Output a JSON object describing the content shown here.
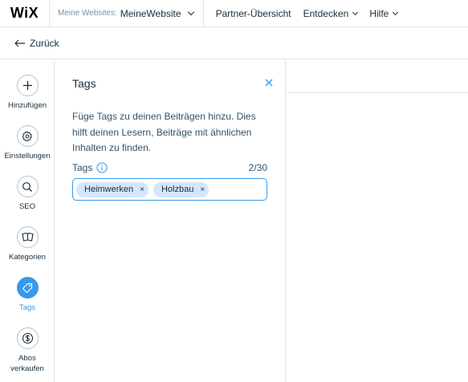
{
  "topbar": {
    "logo": "WiX",
    "site_prefix": "Meine Websites:",
    "site_name": "MeineWebsite",
    "nav": [
      {
        "label": "Partner-Übersicht"
      },
      {
        "label": "Entdecken"
      },
      {
        "label": "Hilfe"
      }
    ]
  },
  "back": {
    "label": "Zurück"
  },
  "rail": {
    "items": [
      {
        "label": "Hinzufügen",
        "icon": "plus-icon"
      },
      {
        "label": "Einstellungen",
        "icon": "gear-icon"
      },
      {
        "label": "SEO",
        "icon": "search-icon"
      },
      {
        "label": "Kategorien",
        "icon": "category-icon"
      },
      {
        "label": "Tags",
        "icon": "tag-icon",
        "active": true
      },
      {
        "label": "Abos verkaufen",
        "icon": "dollar-icon"
      }
    ]
  },
  "panel": {
    "title": "Tags",
    "description": "Füge Tags zu deinen Beiträgen hinzu. Dies hilft deinen Lesern, Beiträge mit ähnlichen Inhalten zu finden.",
    "tags_label": "Tags",
    "tags_count": "2/30",
    "tags": [
      {
        "label": "Heimwerken",
        "remove": "×"
      },
      {
        "label": "Holzbau",
        "remove": "×"
      }
    ],
    "input_value": ""
  },
  "colors": {
    "accent": "#3899ec",
    "chip": "#d6e6fe",
    "text": "#162d3d",
    "border": "#dfe5eb"
  }
}
